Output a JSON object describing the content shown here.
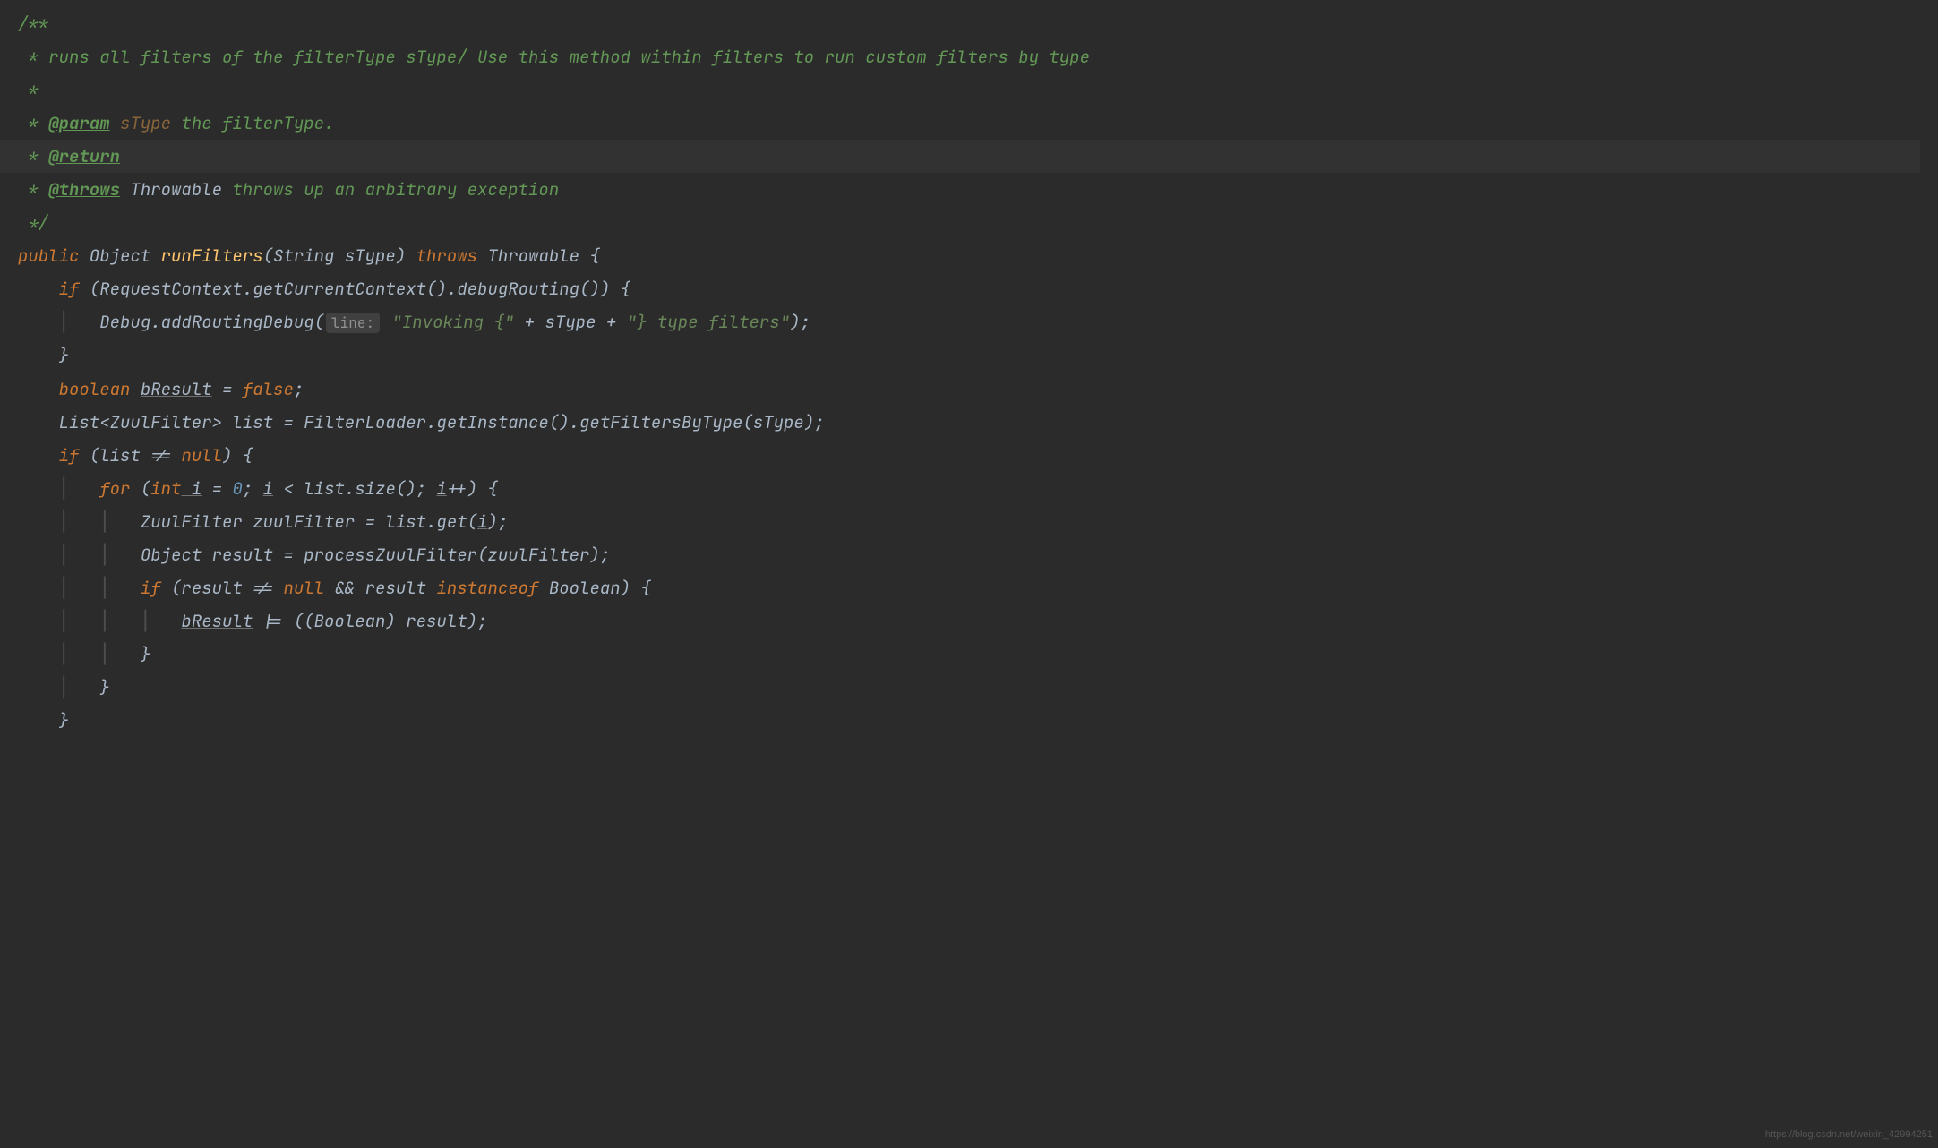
{
  "code": {
    "l1": "/**",
    "l2_pre": " * ",
    "l2_text": "runs all filters of the filterType sType/ Use this method within filters to run custom filters by type",
    "l3": " *",
    "l4_pre": " * ",
    "l4_tag": "@param",
    "l4_param": " sType",
    "l4_rest": " the filterType.",
    "l5_pre": " * ",
    "l5_tag": "@return",
    "l6_pre": " * ",
    "l6_tag": "@throws",
    "l6_class": " Throwable",
    "l6_rest": " throws up an arbitrary exception",
    "l7": " */",
    "l8_public": "public",
    "l8_object": " Object ",
    "l8_method": "runFilters",
    "l8_params": "(String sType) ",
    "l8_throws": "throws",
    "l8_throwable": " Throwable {",
    "l9_if": "if",
    "l9_open": " (RequestContext.",
    "l9_static": "getCurrentContext",
    "l9_rest": "().debugRouting()) {",
    "l10_debug": "Debug.",
    "l10_static": "addRoutingDebug",
    "l10_op": "(",
    "l10_hint": "line:",
    "l10_str1": "\"Invoking {\"",
    "l10_plus1": " + sType + ",
    "l10_str2": "\"} type filters\"",
    "l10_close": ");",
    "l11_close": "}",
    "l12_bool": "boolean",
    "l12_var": "bResult",
    "l12_eq": " = ",
    "l12_false": "false",
    "l12_semi": ";",
    "l13_list": "List<ZuulFilter> list = FilterLoader.",
    "l13_static": "getInstance",
    "l13_rest": "().getFiltersByType(sType);",
    "l14_if": "if",
    "l14_cond": " (list != ",
    "l14_null": "null",
    "l14_close": ") {",
    "l15_for": "for",
    "l15_open": " (",
    "l15_int": "int",
    "l15_i1": " i",
    "l15_eq": " = ",
    "l15_zero": "0",
    "l15_semi1": "; ",
    "l15_i2": "i",
    "l15_lt": " < list.size(); ",
    "l15_i3": "i",
    "l15_inc": "++) {",
    "l16_decl": "ZuulFilter zuulFilter = list.get(",
    "l16_i": "i",
    "l16_close": ");",
    "l17": "Object result = processZuulFilter(zuulFilter);",
    "l18_if": "if",
    "l18_open": " (result != ",
    "l18_null": "null",
    "l18_amp": " && result ",
    "l18_inst": "instanceof",
    "l18_bool": " Boolean) {",
    "l19_var": "bResult",
    "l19_rest": " |= ((Boolean) result);",
    "l20": "}",
    "l21": "}",
    "l22": "}"
  },
  "watermark": "https://blog.csdn.net/weixin_42994251"
}
